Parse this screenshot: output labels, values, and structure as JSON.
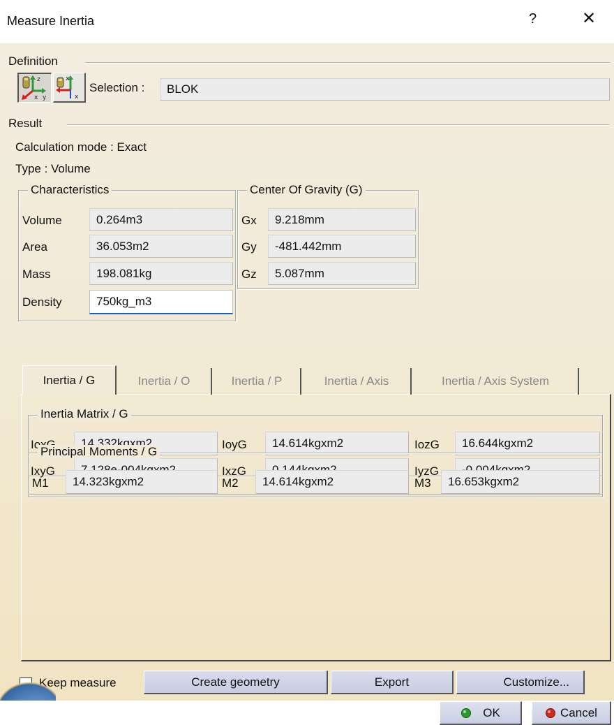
{
  "window": {
    "title": "Measure Inertia",
    "help": "?",
    "close": "✕"
  },
  "definition": {
    "label": "Definition",
    "selection_label": "Selection :",
    "selection_value": "BLOK"
  },
  "result": {
    "label": "Result",
    "calc_mode": "Calculation mode : Exact",
    "type": "Type : Volume"
  },
  "characteristics": {
    "label": "Characteristics",
    "rows": [
      {
        "label": "Volume",
        "value": "0.264m3"
      },
      {
        "label": "Area",
        "value": "36.053m2"
      },
      {
        "label": "Mass",
        "value": "198.081kg"
      },
      {
        "label": "Density",
        "value": "750kg_m3"
      }
    ]
  },
  "cog": {
    "label": "Center Of Gravity (G)",
    "rows": [
      {
        "label": "Gx",
        "value": "9.218mm"
      },
      {
        "label": "Gy",
        "value": "-481.442mm"
      },
      {
        "label": "Gz",
        "value": "5.087mm"
      }
    ]
  },
  "tabs": [
    "Inertia / G",
    "Inertia / O",
    "Inertia / P",
    "Inertia / Axis",
    "Inertia / Axis System"
  ],
  "inertia_matrix": {
    "label": "Inertia Matrix / G",
    "row1": [
      {
        "label": "IoxG",
        "value": "14.332kgxm2"
      },
      {
        "label": "IoyG",
        "value": "14.614kgxm2"
      },
      {
        "label": "IozG",
        "value": "16.644kgxm2"
      }
    ],
    "row2": [
      {
        "label": "IxyG",
        "value": "7.128e-004kgxm2"
      },
      {
        "label": "IxzG",
        "value": "0.144kgxm2"
      },
      {
        "label": "IyzG",
        "value": "-0.004kgxm2"
      }
    ]
  },
  "principal": {
    "label": "Principal Moments / G",
    "row": [
      {
        "label": "M1",
        "value": "14.323kgxm2"
      },
      {
        "label": "M2",
        "value": "14.614kgxm2"
      },
      {
        "label": "M3",
        "value": "16.653kgxm2"
      }
    ]
  },
  "footer": {
    "keep_measure": "Keep measure",
    "create_geometry": "Create geometry",
    "export": "Export",
    "customize": "Customize...",
    "ok": "OK",
    "cancel": "Cancel"
  }
}
